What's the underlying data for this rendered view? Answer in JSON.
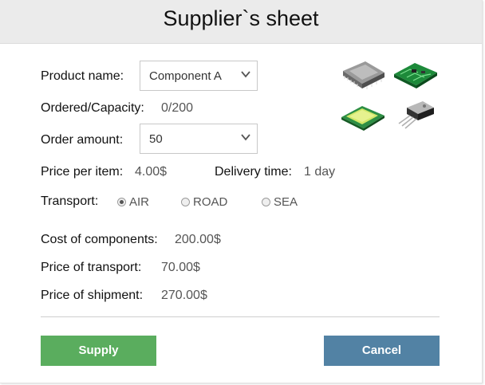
{
  "dialog": {
    "title": "Supplier`s sheet"
  },
  "form": {
    "product_name": {
      "label": "Product name:",
      "value": "Component A"
    },
    "ordered_capacity": {
      "label": "Ordered/Capacity:",
      "value": "0/200"
    },
    "order_amount": {
      "label": "Order amount:",
      "value": "50"
    },
    "price_per_item": {
      "label": "Price per item:",
      "value": "4.00$"
    },
    "delivery_time": {
      "label": "Delivery time:",
      "value": "1 day"
    },
    "transport": {
      "label": "Transport:",
      "options": [
        {
          "label": "AIR",
          "checked": true
        },
        {
          "label": "ROAD",
          "checked": false
        },
        {
          "label": "SEA",
          "checked": false
        }
      ]
    }
  },
  "summary": {
    "cost_of_components": {
      "label": "Cost of components:",
      "value": "200.00$"
    },
    "price_of_transport": {
      "label": "Price of transport:",
      "value": "70.00$"
    },
    "price_of_shipment": {
      "label": "Price of shipment:",
      "value": "270.00$"
    }
  },
  "buttons": {
    "supply": "Supply",
    "cancel": "Cancel"
  },
  "icons": [
    "cpu-chip-icon",
    "circuit-board-icon",
    "lcd-module-icon",
    "transistor-icon"
  ],
  "colors": {
    "supply": "#5aad5e",
    "cancel": "#5282a4",
    "header_bg": "#ebebeb"
  }
}
